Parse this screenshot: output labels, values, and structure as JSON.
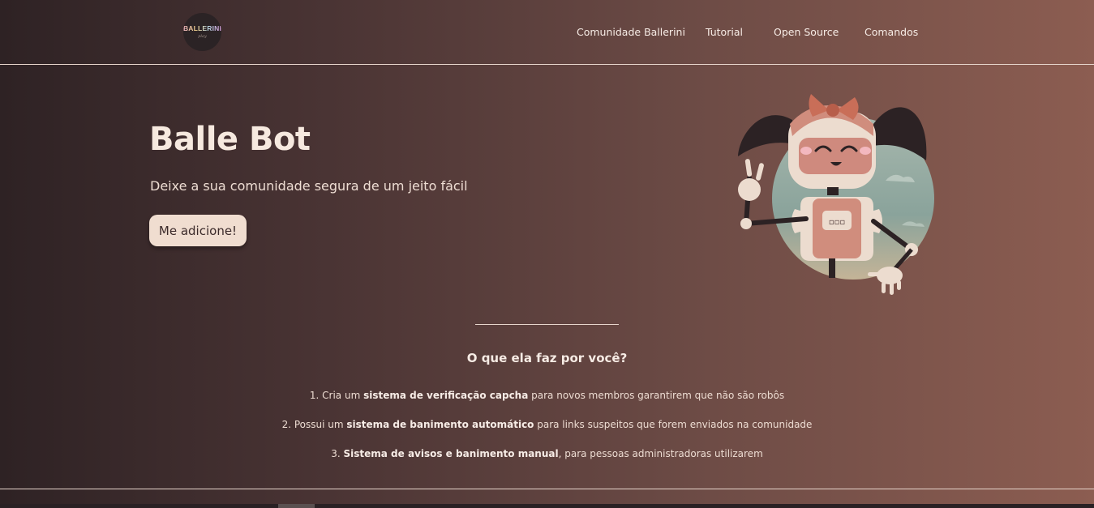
{
  "nav": {
    "logo_text": "BALLERINI",
    "logo_sub": "play",
    "links": [
      "Comunidade Ballerini",
      "Tutorial",
      "Open Source",
      "Comandos"
    ]
  },
  "hero": {
    "title": "Balle Bot",
    "subtitle": "Deixe a sua comunidade segura de um jeito fácil",
    "button": "Me adicione!",
    "robot_chest": "▫▫▫"
  },
  "features": {
    "title": "O que ela faz por você?",
    "items": [
      {
        "prefix": "1. Cria um ",
        "bold": "sistema de verificação capcha",
        "suffix": " para novos membros garantirem que não são robôs"
      },
      {
        "prefix": "2. Possui um ",
        "bold": "sistema de banimento automático",
        "suffix": " para links suspeitos que forem enviados na comunidade"
      },
      {
        "prefix": "3. ",
        "bold": "Sistema de avisos e banimento manual",
        "suffix": ", para pessoas administradoras utilizarem"
      }
    ]
  },
  "colors": {
    "gradient_start": "#2e2224",
    "gradient_end": "#8c5d51",
    "button_bg": "#f0ddd0",
    "text": "#f1e1d6"
  }
}
